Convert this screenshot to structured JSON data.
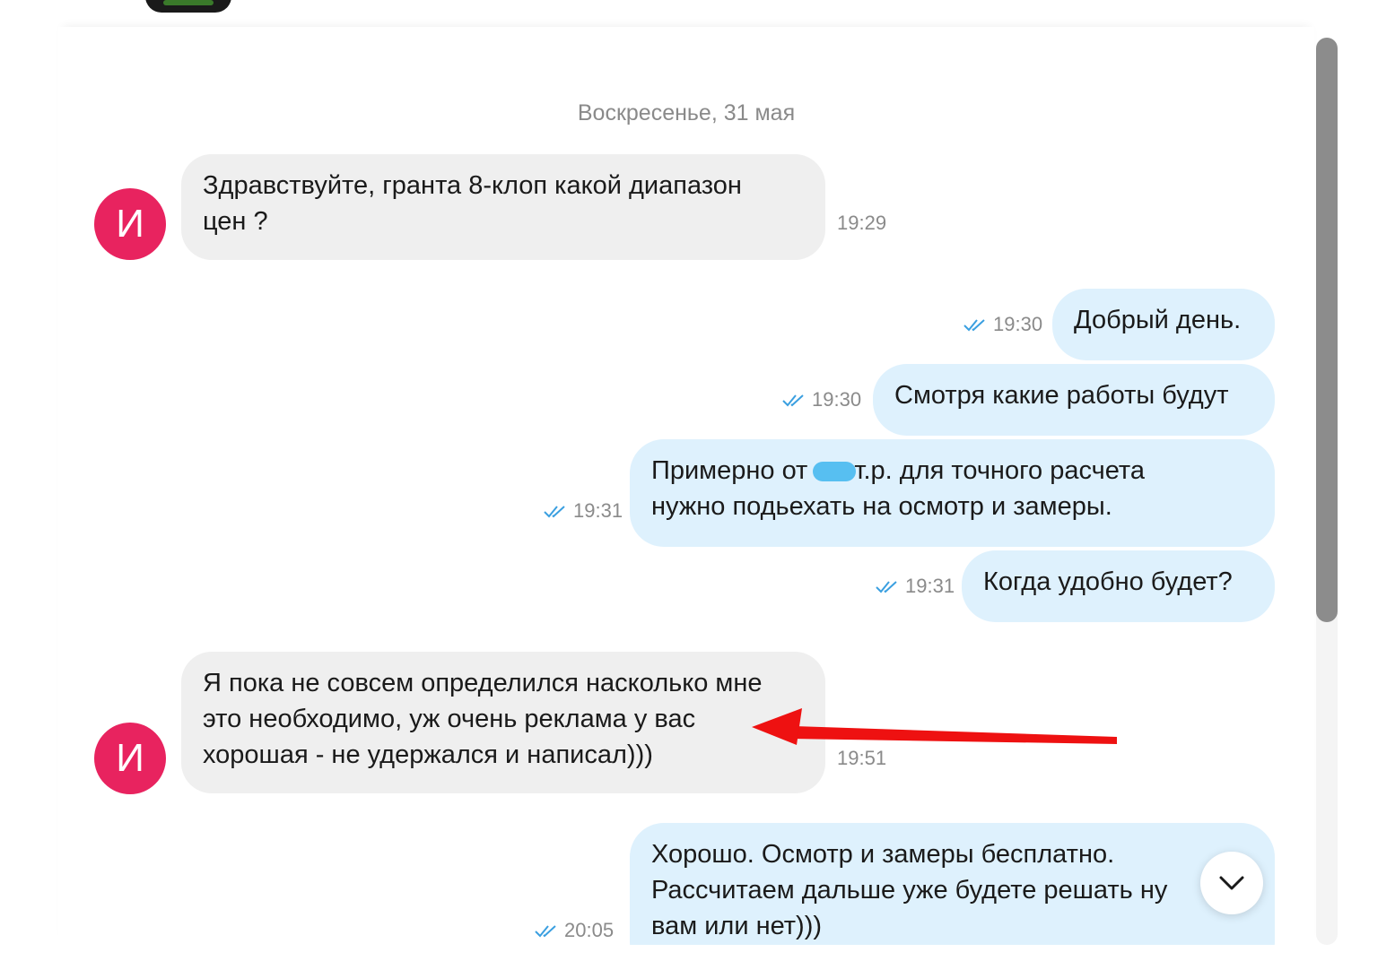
{
  "date_separator": "Воскресенье, 31 мая",
  "messages": [
    {
      "direction": "in",
      "avatar_letter": "И",
      "lines": [
        "Здравствуйте, гранта 8-клоп какой диапазон",
        "цен ?"
      ],
      "time": "19:29"
    },
    {
      "direction": "out",
      "lines": [
        "Добрый день."
      ],
      "time": "19:30",
      "read": true
    },
    {
      "direction": "out",
      "lines": [
        "Смотря какие работы будут"
      ],
      "time": "19:30",
      "read": true
    },
    {
      "direction": "out",
      "line1_pre": "Примерно от",
      "line1_post": "т.р. для точного расчета",
      "line2": "нужно подьехать на осмотр и замеры.",
      "time": "19:31",
      "read": true
    },
    {
      "direction": "out",
      "lines": [
        "Когда удобно будет?"
      ],
      "time": "19:31",
      "read": true
    },
    {
      "direction": "in",
      "avatar_letter": "И",
      "lines": [
        "Я пока не совсем определился насколько мне",
        "это необходимо, уж очень реклама у вас",
        "хорошая - не удержался и написал)))"
      ],
      "time": "19:51"
    },
    {
      "direction": "out",
      "lines": [
        "Хорошо. Осмотр и замеры бесплатно.",
        "Рассчитаем дальше уже будете решать ну",
        "вам или нет)))"
      ],
      "time": "20:05",
      "read": true
    }
  ],
  "colors": {
    "incoming_bubble": "#efefef",
    "outgoing_bubble": "#def1fd",
    "avatar": "#e8235f",
    "read_checks": "#3a9fe0",
    "annotation_arrow": "#ee1111"
  },
  "icons": {
    "read_receipt": "double-check-icon",
    "scroll_down": "chevron-down-icon"
  }
}
